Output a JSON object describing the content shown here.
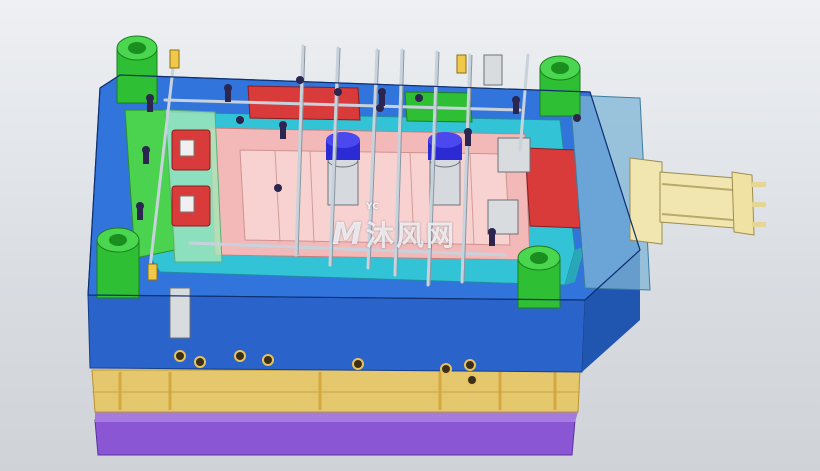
{
  "scene": {
    "subject": "",
    "colors": {
      "background": "#dde0e4",
      "clamp_plate_top": "#2a63c9",
      "cavity_plate": "#32c3d6",
      "core_plate": "#f2b9b8",
      "support_plate": "#e7c65a",
      "bottom_plate": "#8b56d4",
      "leader_bushing": "#2fbf34",
      "slider_block": "#d93b3b",
      "hydraulic_cylinder": "#f1e6b0",
      "cylinder_housing": "#7fb6d6",
      "cooling_hose": "#c8d2dc",
      "screw": "#2b2550"
    }
  },
  "watermark": {
    "logo": "M",
    "sub": "YC",
    "text": "沐风网"
  }
}
